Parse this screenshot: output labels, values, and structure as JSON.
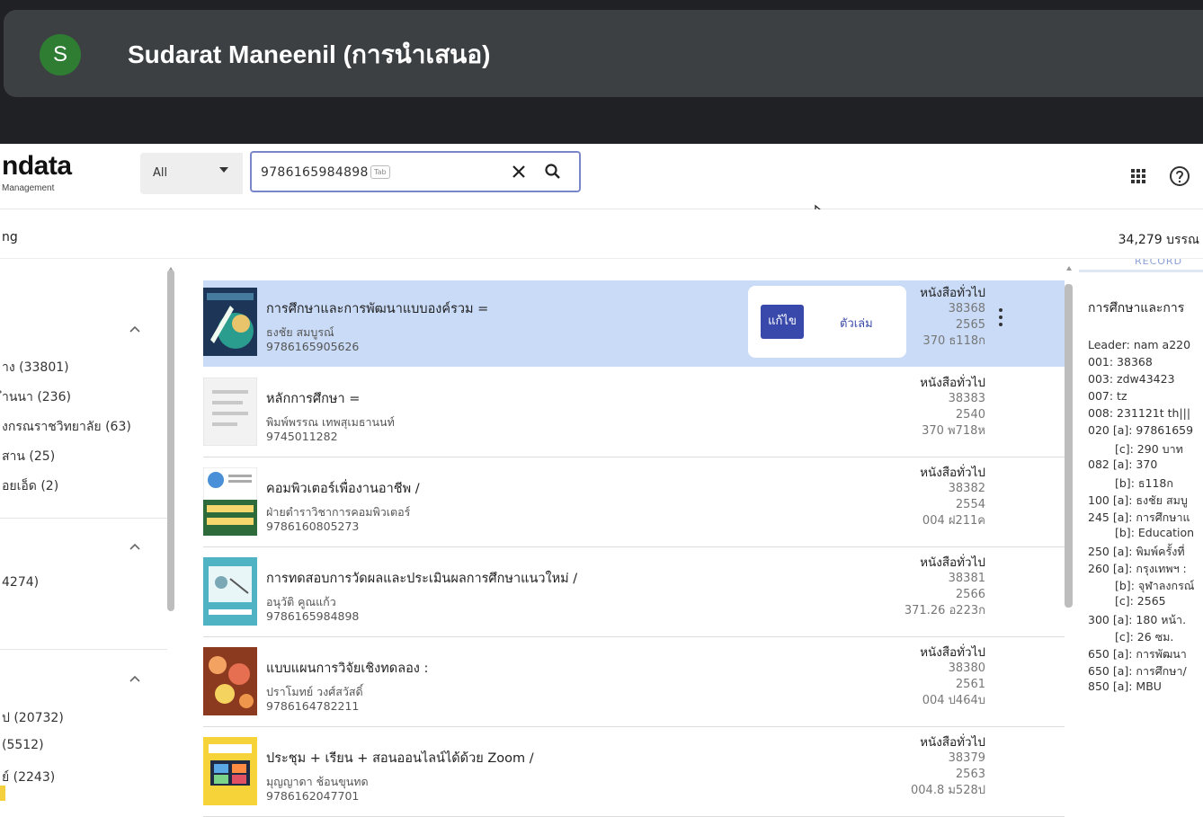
{
  "presenter": {
    "avatar_letter": "S",
    "name": "Sudarat Maneenil (การนำเสนอ)",
    "avatar_color": "#2e7d32"
  },
  "app": {
    "logo": "ndata",
    "logo_sub": "Management"
  },
  "search": {
    "scope": "All",
    "value": "9786165984898",
    "tab_hint": "Tab"
  },
  "toolbar": {
    "left_text": "ng",
    "right_text": "34,279 บรรณ"
  },
  "facets": [
    {
      "items": [
        "าง (33801)",
        "ำนนา (236)",
        "งกรณราชวิทยาลัย (63)",
        "สาน (25)",
        "อยเอ็ด (2)"
      ]
    },
    {
      "items": [
        "4274)"
      ]
    },
    {
      "items": [
        "ป (20732)",
        "(5512)",
        "ย์ (2243)"
      ]
    }
  ],
  "actions": {
    "edit": "แก้ไข",
    "items": "ตัวเล่ม"
  },
  "results": [
    {
      "title": "การศึกษาและการพัฒนาแบบองค์รวม =",
      "author": "ธงชัย สมบูรณ์",
      "isbn": "9786165905626",
      "type": "หนังสือทั่วไป",
      "id": "38368",
      "year": "2565",
      "call": "370 ธ118ก",
      "selected": true,
      "cover": "cover-1"
    },
    {
      "title": "หลักการศึกษา =",
      "author": "พิมพ์พรรณ เทพสุเมธานนท์",
      "isbn": "9745011282",
      "type": "หนังสือทั่วไป",
      "id": "38383",
      "year": "2540",
      "call": "370 พ718ห",
      "selected": false,
      "cover": "cover-2"
    },
    {
      "title": "คอมพิวเตอร์เพื่องานอาชีพ /",
      "author": "ฝ่ายตำราวิชาการคอมพิวเตอร์",
      "isbn": "9786160805273",
      "type": "หนังสือทั่วไป",
      "id": "38382",
      "year": "2554",
      "call": "004 ฝ211ค",
      "selected": false,
      "cover": "cover-3"
    },
    {
      "title": "การทดสอบการวัดผลและประเมินผลการศึกษาแนวใหม่ /",
      "author": "อนุวัติ คูณแก้ว",
      "isbn": "9786165984898",
      "type": "หนังสือทั่วไป",
      "id": "38381",
      "year": "2566",
      "call": "371.26 อ223ก",
      "selected": false,
      "cover": "cover-4"
    },
    {
      "title": "แบบแผนการวิจัยเชิงทดลอง :",
      "author": "ปราโมทย์ วงศ์สวัสดิ์",
      "isbn": "9786164782211",
      "type": "หนังสือทั่วไป",
      "id": "38380",
      "year": "2561",
      "call": "004 ป464บ",
      "selected": false,
      "cover": "cover-5"
    },
    {
      "title": "ประชุม + เรียน + สอนออนไลน์ได้ด้วย Zoom /",
      "author": "มุญญาดา ช้อนขุนทด",
      "isbn": "9786162047701",
      "type": "หนังสือทั่วไป",
      "id": "38379",
      "year": "2563",
      "call": "004.8 ม528ป",
      "selected": false,
      "cover": "cover-6"
    }
  ],
  "marc": {
    "tab": "RECORD",
    "title": "การศึกษาและการ",
    "lines": [
      "Leader: nam a220",
      "001: 38368",
      "003: zdw43423",
      "007: tz",
      "008: 231121t th|||",
      "020 [a]: 97861659",
      "[c]: 290 บาท",
      "082 [a]: 370",
      "[b]: ธ118ก",
      "100 [a]: ธงชัย สมบู",
      "245 [a]: การศึกษาแ",
      "[b]: Education",
      "250 [a]: พิมพ์ครั้งที่",
      "260 [a]: กรุงเทพฯ :",
      "[b]: จุฬาลงกรณ์",
      "[c]: 2565",
      "300 [a]: 180 หน้า.",
      "[c]: 26 ซม.",
      "650 [a]: การพัฒนา",
      "650 [a]: การศึกษา/",
      "850 [a]: MBU"
    ]
  },
  "colors": {
    "accent": "#3949ab",
    "selected_row": "#c9dbf7",
    "presenter_bar": "#3c4043",
    "search_border": "#7a86c9"
  }
}
